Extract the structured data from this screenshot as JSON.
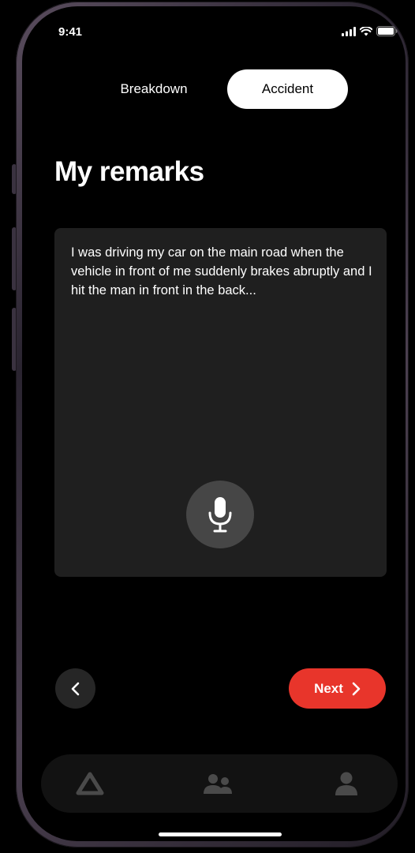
{
  "status_bar": {
    "time": "9:41"
  },
  "segmented_control": {
    "options": [
      "Breakdown",
      "Accident"
    ],
    "selected": "Accident"
  },
  "page": {
    "title": "My remarks"
  },
  "remarks": {
    "text": "I was driving my car on the main road when the vehicle in front of me suddenly brakes abruptly and I hit the man in front in the back..."
  },
  "actions": {
    "next_label": "Next"
  },
  "tab_bar": {
    "icons": [
      "warning-triangle-icon",
      "people-icon",
      "person-icon"
    ]
  },
  "colors": {
    "accent": "#e8352b",
    "background": "#000000",
    "panel": "#1f1f1f"
  }
}
